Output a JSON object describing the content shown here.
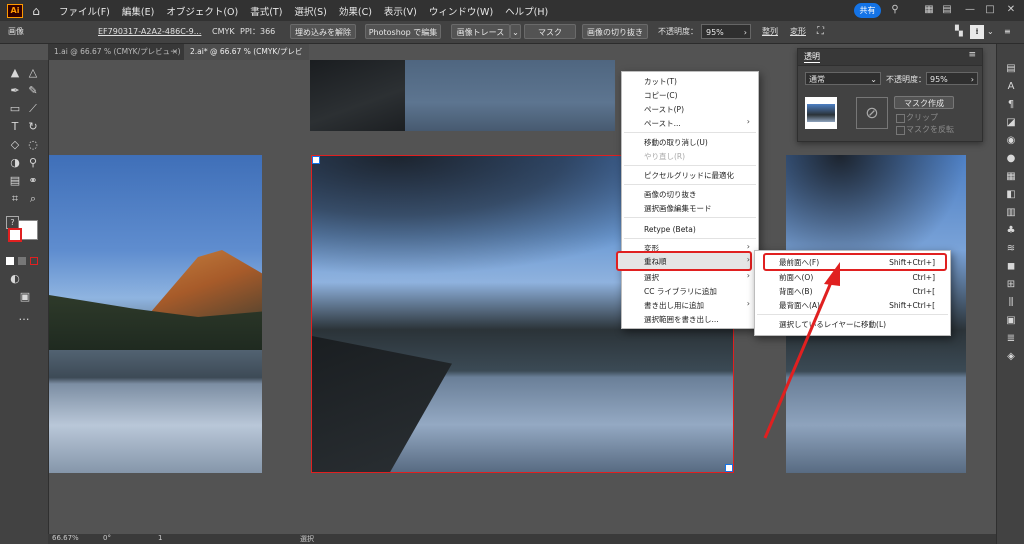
{
  "menubar": {
    "logo": "Ai",
    "items": [
      "ファイル(F)",
      "編集(E)",
      "オブジェクト(O)",
      "書式(T)",
      "選択(S)",
      "効果(C)",
      "表示(V)",
      "ウィンドウ(W)",
      "ヘルプ(H)"
    ],
    "share_label": "共有",
    "icons": [
      "home-icon",
      "search-icon",
      "arrange-documents-icon",
      "workspace-icon",
      "minimize-icon",
      "maximize-icon",
      "close-icon"
    ]
  },
  "control_bar": {
    "object_type": "画像",
    "file_name": "EF790317-A2A2-486C-9...",
    "color_mode": "CMYK",
    "ppi": "PPI：366",
    "embed_button": "埋め込みを解除",
    "photoshop_button": "Photoshop で編集",
    "trace_button": "画像トレース",
    "mask_button": "マスク",
    "crop_button": "画像の切り抜き",
    "opacity_label": "不透明度：",
    "opacity_value": "95%",
    "align_label": "整列",
    "transform_label": "変形"
  },
  "tabs": [
    {
      "label": "1.ai @ 66.67 % (CMYK/プレビュー)",
      "active": false
    },
    {
      "label": "2.ai* @ 66.67 % (CMYK/プレビュー)",
      "active": true
    }
  ],
  "transparency_panel": {
    "title": "透明",
    "blend_mode": "通常",
    "opacity_label": "不透明度：",
    "opacity_value": "95%",
    "make_mask_button": "マスク作成",
    "clip_label": "クリップ",
    "invert_mask_label": "マスクを反転"
  },
  "context_menu": {
    "items": [
      {
        "label": "カット(T)",
        "enabled": true
      },
      {
        "label": "コピー(C)",
        "enabled": true
      },
      {
        "label": "ペースト(P)",
        "enabled": true
      },
      {
        "label": "ペースト...",
        "enabled": true,
        "submenu": true
      },
      {
        "label": "移動の取り消し(U)",
        "enabled": true
      },
      {
        "label": "やり直し(R)",
        "enabled": false
      },
      {
        "label": "ピクセルグリッドに最適化",
        "enabled": true
      },
      {
        "label": "画像の切り抜き",
        "enabled": true
      },
      {
        "label": "選択画像編集モード",
        "enabled": true
      },
      {
        "label": "Retype (Beta)",
        "enabled": true
      },
      {
        "label": "変形",
        "enabled": true,
        "submenu": true
      },
      {
        "label": "重ね順",
        "enabled": true,
        "submenu": true,
        "highlighted": true
      },
      {
        "label": "選択",
        "enabled": true,
        "submenu": true
      },
      {
        "label": "CC ライブラリに追加",
        "enabled": true
      },
      {
        "label": "書き出し用に追加",
        "enabled": true,
        "submenu": true
      },
      {
        "label": "選択範囲を書き出し...",
        "enabled": true
      }
    ]
  },
  "arrange_submenu": {
    "items": [
      {
        "label": "最前面へ(F)",
        "shortcut": "Shift+Ctrl+]",
        "highlighted": true
      },
      {
        "label": "前面へ(O)",
        "shortcut": "Ctrl+]"
      },
      {
        "label": "背面へ(B)",
        "shortcut": "Ctrl+["
      },
      {
        "label": "最背面へ(A)",
        "shortcut": "Shift+Ctrl+["
      },
      {
        "label": "選択しているレイヤーに移動(L)",
        "shortcut": ""
      }
    ]
  },
  "status_bar": {
    "zoom": "66.67%",
    "rotation": "0°",
    "artboard": "1",
    "tool": "選択"
  },
  "colors": {
    "highlight_red": "#e02020",
    "accent_blue": "#1473e6",
    "panel_bg": "#424242",
    "canvas_bg": "#535353"
  }
}
